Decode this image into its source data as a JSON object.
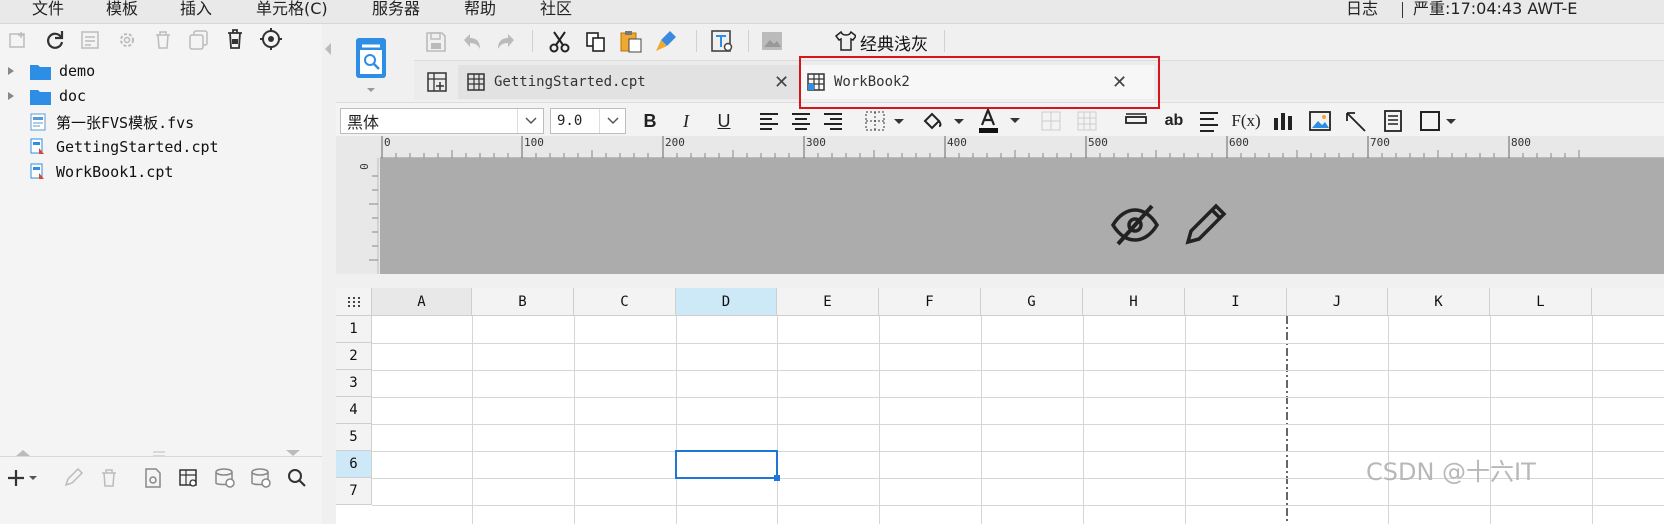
{
  "menubar": {
    "items": [
      "文件",
      "模板",
      "插入",
      "单元格(C)",
      "服务器",
      "帮助",
      "社区"
    ],
    "log_label": "日志",
    "status": "严重:17:04:43 AWT-E"
  },
  "left_panel": {
    "toolbar_icons": [
      "new-file-icon",
      "refresh-icon",
      "properties-icon",
      "settings-icon",
      "delete-icon",
      "copy-icon",
      "lock-icon",
      "locate-icon"
    ],
    "tree": [
      {
        "label": "demo",
        "type": "folder",
        "expandable": true
      },
      {
        "label": "doc",
        "type": "folder",
        "expandable": true
      },
      {
        "label": "第一张FVS模板.fvs",
        "type": "fvs"
      },
      {
        "label": "GettingStarted.cpt",
        "type": "cpt"
      },
      {
        "label": "WorkBook1.cpt",
        "type": "cpt"
      }
    ],
    "bottom_icons": [
      "add-icon",
      "edit-icon",
      "delete-icon",
      "preview-icon",
      "table-query-icon",
      "database-add-icon",
      "database-icon",
      "search-icon"
    ]
  },
  "toolbar": {
    "theme_label": "经典浅灰"
  },
  "tabs": [
    {
      "label": "GettingStarted.cpt",
      "active": false
    },
    {
      "label": "WorkBook2",
      "active": true
    }
  ],
  "format": {
    "font_family": "黑体",
    "font_size": "9.0",
    "bold": "B",
    "italic": "I",
    "underline": "U",
    "text_abbr": "ab",
    "formula": "F(x)"
  },
  "ruler": {
    "labels": [
      "0",
      "100",
      "200",
      "300",
      "400",
      "500",
      "600",
      "700",
      "800"
    ],
    "vertical_label": "0"
  },
  "sheet": {
    "columns": [
      "A",
      "B",
      "C",
      "D",
      "E",
      "F",
      "G",
      "H",
      "I",
      "J",
      "K",
      "L"
    ],
    "rows": [
      "1",
      "2",
      "3",
      "4",
      "5",
      "6",
      "7"
    ],
    "active_column": "D",
    "active_row": "6"
  },
  "watermark": "CSDN @十六IT",
  "colors": {
    "highlight": "#d9141b",
    "selection": "#1f75d8",
    "active_header": "#cde9f7"
  }
}
